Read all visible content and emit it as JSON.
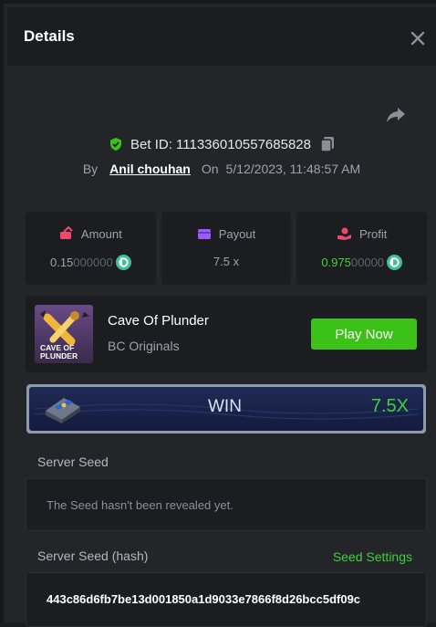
{
  "header": {
    "title": "Details"
  },
  "bet": {
    "id_text": "Bet ID: 111336010557685828",
    "by_label": "By",
    "user": "Anil chouhan",
    "on_label": "On",
    "datetime": "5/12/2023, 11:48:57 AM"
  },
  "stats": {
    "amount": {
      "label": "Amount",
      "value_main": "0.15",
      "value_dim": "000000"
    },
    "payout": {
      "label": "Payout",
      "value": "7.5 x"
    },
    "profit": {
      "label": "Profit",
      "value_main": "0.975",
      "value_dim": "00000"
    }
  },
  "game": {
    "thumb_line1": "CAVE OF",
    "thumb_line2": "PLUNDER",
    "name": "Cave Of Plunder",
    "provider": "BC Originals",
    "play_label": "Play Now"
  },
  "result": {
    "label": "WIN",
    "multiplier": "7.5X"
  },
  "server_seed": {
    "label": "Server Seed",
    "placeholder": "The Seed hasn't been revealed yet."
  },
  "server_seed_hash": {
    "label": "Server Seed (hash)",
    "settings_label": "Seed Settings",
    "value": "443c86d6fb7be13d001850a1d9033e7866f8d26bcc5df09c"
  },
  "colors": {
    "accent_green": "#3bc117",
    "profit_green": "#41d13a",
    "background": "#232529",
    "panel": "#1b1d21"
  },
  "icons": [
    "close-icon",
    "share-icon",
    "shield-check-icon",
    "copy-icon",
    "money-icon",
    "wallet-icon",
    "profit-hand-icon",
    "coin-icon",
    "chest-icon"
  ]
}
